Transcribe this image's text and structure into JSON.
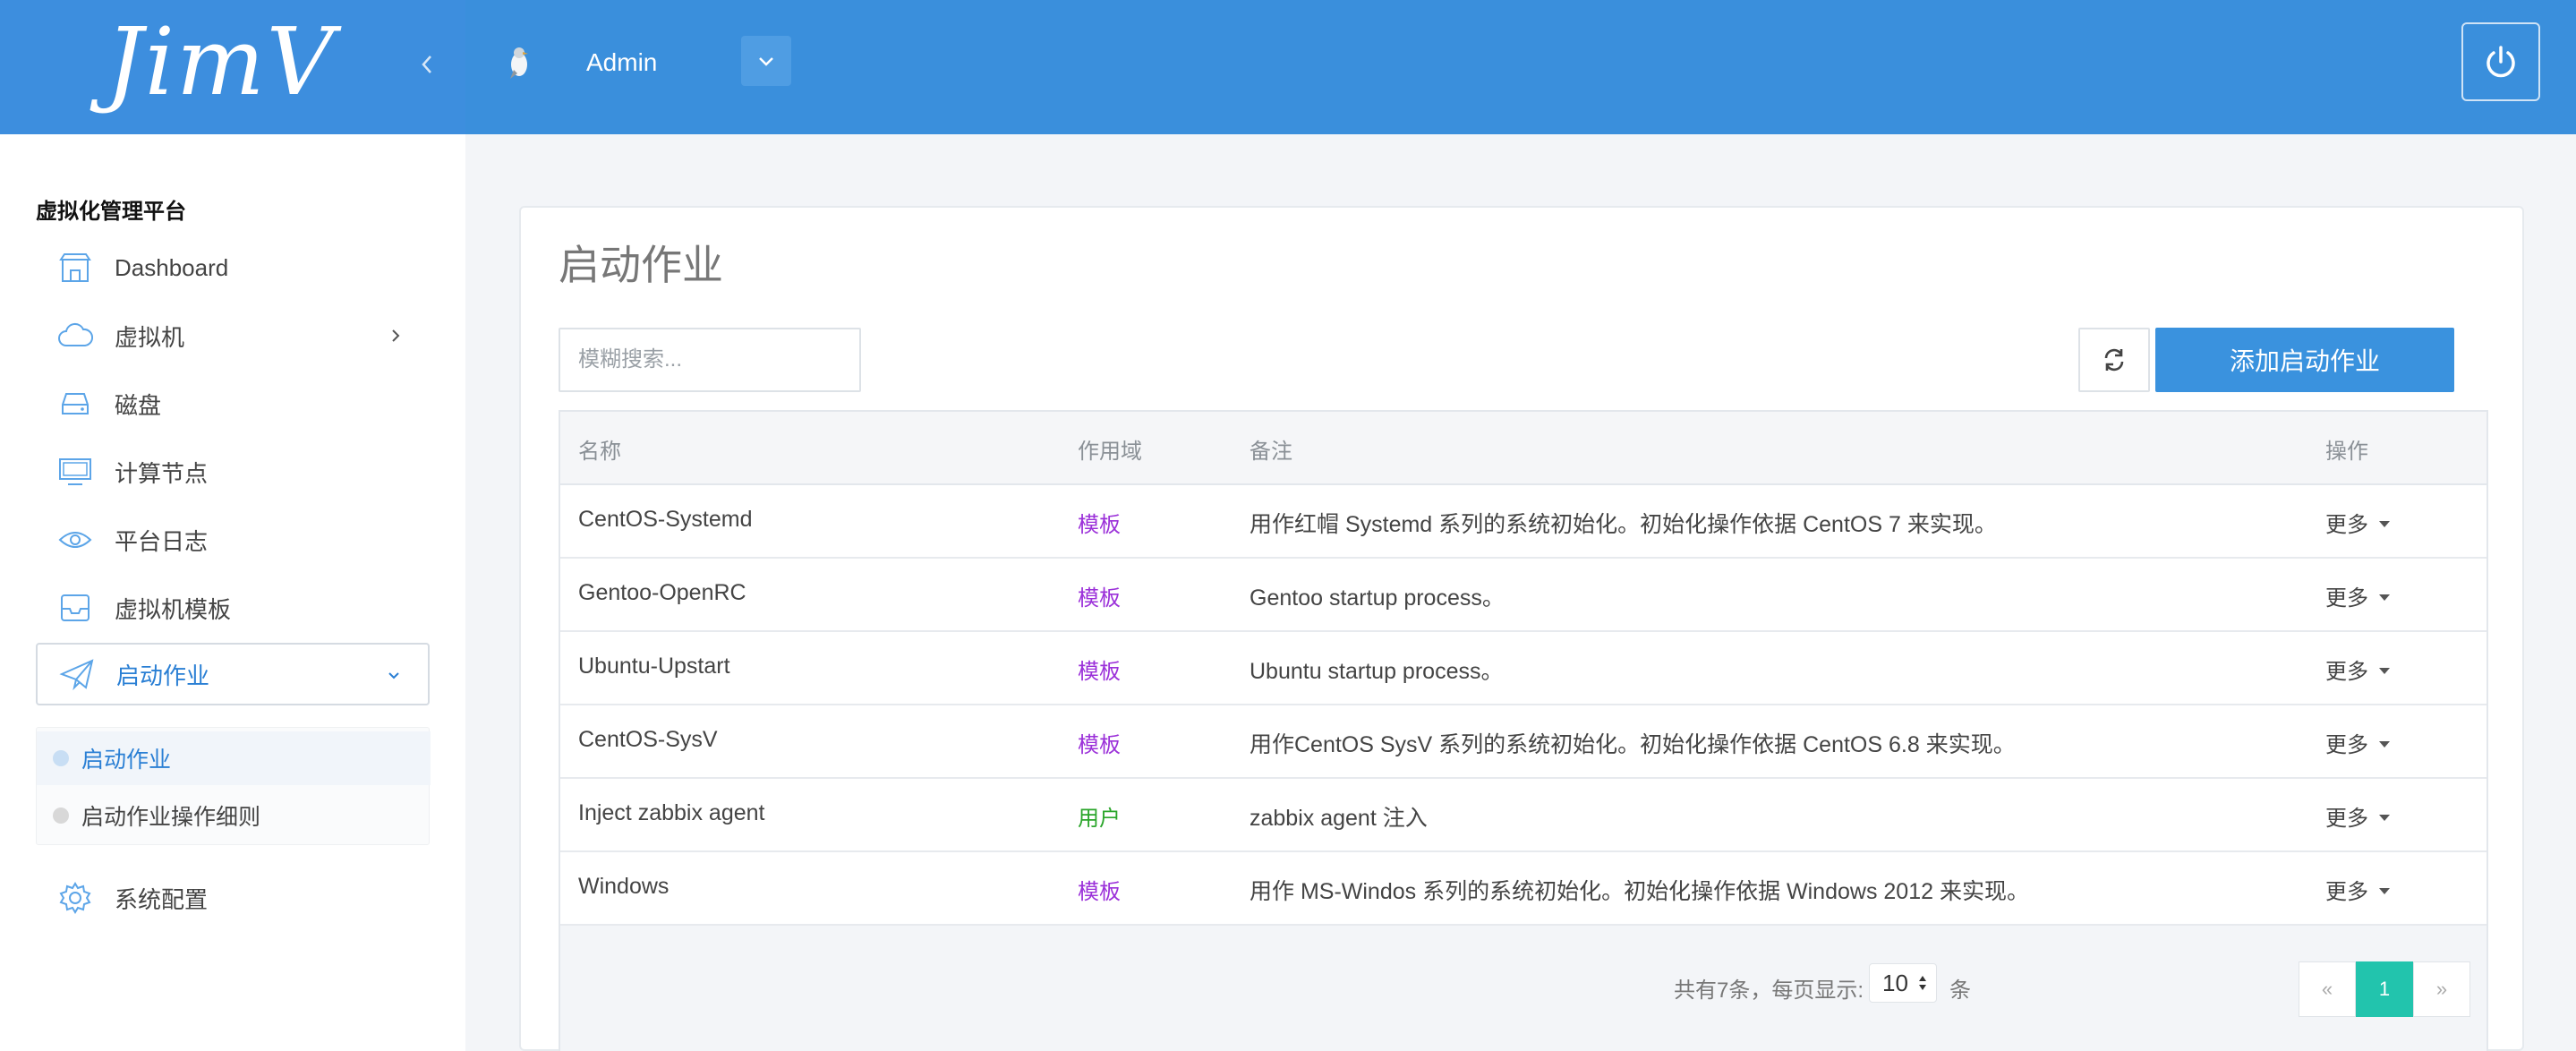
{
  "header": {
    "logo_text": "JimV",
    "user_name": "Admin"
  },
  "sidebar": {
    "heading": "虚拟化管理平台",
    "items": [
      {
        "label": "Dashboard",
        "icon": "store-icon"
      },
      {
        "label": "虚拟机",
        "icon": "cloud-icon"
      },
      {
        "label": "磁盘",
        "icon": "disk-icon"
      },
      {
        "label": "计算节点",
        "icon": "monitor-icon"
      },
      {
        "label": "平台日志",
        "icon": "eye-icon"
      },
      {
        "label": "虚拟机模板",
        "icon": "inbox-icon"
      },
      {
        "label": "启动作业",
        "icon": "paper-plane-icon"
      },
      {
        "label": "系统配置",
        "icon": "gear-icon"
      }
    ],
    "subitems": [
      {
        "label": "启动作业"
      },
      {
        "label": "启动作业操作细则"
      }
    ]
  },
  "main": {
    "title": "启动作业",
    "search_placeholder": "模糊搜索...",
    "add_button": "添加启动作业",
    "columns": [
      "名称",
      "作用域",
      "备注",
      "操作"
    ],
    "rows": [
      {
        "name": "CentOS-Systemd",
        "scope": "模板",
        "scope_color": "#9b30d9",
        "note": "用作红帽 Systemd 系列的系统初始化。初始化操作依据 CentOS 7 来实现。",
        "action": "更多"
      },
      {
        "name": "Gentoo-OpenRC",
        "scope": "模板",
        "scope_color": "#9b30d9",
        "note": "Gentoo startup process。",
        "action": "更多"
      },
      {
        "name": "Ubuntu-Upstart",
        "scope": "模板",
        "scope_color": "#9b30d9",
        "note": "Ubuntu startup process。",
        "action": "更多"
      },
      {
        "name": "CentOS-SysV",
        "scope": "模板",
        "scope_color": "#9b30d9",
        "note": "用作CentOS SysV 系列的系统初始化。初始化操作依据 CentOS 6.8 来实现。",
        "action": "更多"
      },
      {
        "name": "Inject zabbix agent",
        "scope": "用户",
        "scope_color": "#2aa52a",
        "note": "zabbix agent 注入",
        "action": "更多"
      },
      {
        "name": "Windows",
        "scope": "模板",
        "scope_color": "#9b30d9",
        "note": "用作 MS-Windos 系列的系统初始化。初始化操作依据 Windows 2012 来实现。",
        "action": "更多"
      }
    ],
    "footer": {
      "total_text": "共有7条，每页显示:",
      "page_size": "10",
      "unit": "条",
      "prev": "«",
      "current_page": "1",
      "next": "»"
    }
  },
  "colors": {
    "topbar": "#3a8fdc",
    "accent": "#3a92de",
    "pager_active": "#22c4ad"
  }
}
